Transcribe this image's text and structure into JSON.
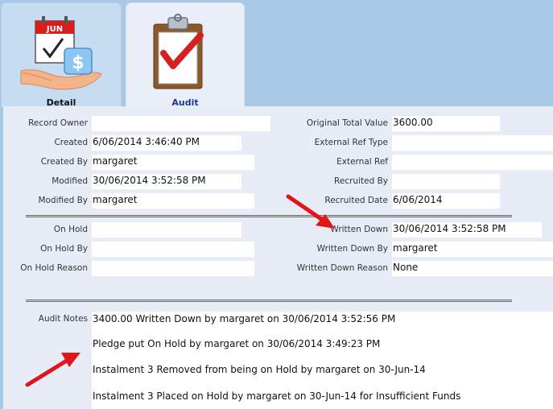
{
  "tabs": [
    {
      "label": "Detail",
      "icon": "calendar-money-icon",
      "calendar_month": "JUN"
    },
    {
      "label": "Audit",
      "icon": "clipboard-check-icon"
    }
  ],
  "left_fields": [
    {
      "label": "Record Owner",
      "value": ""
    },
    {
      "label": "Created",
      "value": "6/06/2014 3:46:40 PM"
    },
    {
      "label": "Created By",
      "value": "margaret"
    },
    {
      "label": "Modified",
      "value": "30/06/2014 3:52:58 PM"
    },
    {
      "label": "Modified By",
      "value": "margaret"
    }
  ],
  "right_fields": [
    {
      "label": "Original Total Value",
      "value": "3600.00"
    },
    {
      "label": "External Ref Type",
      "value": ""
    },
    {
      "label": "External Ref",
      "value": ""
    },
    {
      "label": "Recruited By",
      "value": ""
    },
    {
      "label": "Recruited Date",
      "value": "6/06/2014"
    }
  ],
  "hold_fields": [
    {
      "label": "On Hold",
      "value": ""
    },
    {
      "label": "On Hold By",
      "value": ""
    },
    {
      "label": "On Hold Reason",
      "value": ""
    }
  ],
  "written_fields": [
    {
      "label": "Written Down",
      "value": "30/06/2014 3:52:58 PM"
    },
    {
      "label": "Written Down By",
      "value": "margaret"
    },
    {
      "label": "Written Down Reason",
      "value": "None"
    }
  ],
  "audit_notes": {
    "label": "Audit Notes",
    "lines": [
      "3400.00 Written Down by margaret on 30/06/2014 3:52:56 PM",
      "Pledge put On Hold by margaret on 30/06/2014 3:49:23 PM",
      "Instalment 3 Removed from being on Hold by margaret on 30-Jun-14",
      "Instalment 3 Placed on Hold by margaret on 30-Jun-14 for Insufficient Funds"
    ]
  },
  "colors": {
    "background": "#a9c8e6",
    "panel": "#e8ecf7",
    "active_tab_label": "#1a3a9a",
    "annotation_arrow": "#e0161a"
  }
}
